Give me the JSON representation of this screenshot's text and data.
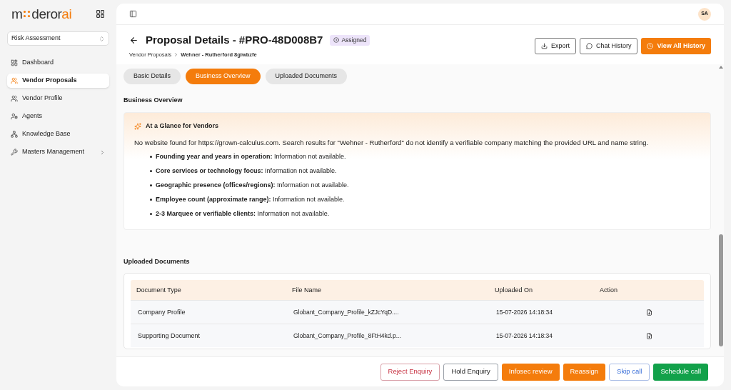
{
  "sidebar": {
    "logo": {
      "start": "m",
      "middle": "deror",
      "accent": "ai"
    },
    "workspace": "Risk Assessment",
    "items": [
      {
        "label": "Dashboard",
        "selected": false,
        "has_children": false
      },
      {
        "label": "Vendor Proposals",
        "selected": true,
        "has_children": false
      },
      {
        "label": "Vendor Profile",
        "selected": false,
        "has_children": false
      },
      {
        "label": "Agents",
        "selected": false,
        "has_children": false
      },
      {
        "label": "Knowledge Base",
        "selected": false,
        "has_children": false
      },
      {
        "label": "Masters Management",
        "selected": false,
        "has_children": true
      }
    ]
  },
  "topbar": {
    "avatar": "SA"
  },
  "header": {
    "title": "Proposal Details - #PRO-48D008B7",
    "status": "Assigned",
    "breadcrumb": [
      "Vendor Proposals",
      "Wehner - Rutherford 8giwbzfe"
    ],
    "actions": [
      {
        "label": "Export",
        "kind": "export"
      },
      {
        "label": "Chat History",
        "kind": "chat"
      },
      {
        "label": "View All History",
        "kind": "history"
      }
    ]
  },
  "tabs": [
    {
      "label": "Basic Details",
      "selected": false
    },
    {
      "label": "Business Overview",
      "selected": true
    },
    {
      "label": "Uploaded Documents",
      "selected": false
    }
  ],
  "business_overview": {
    "heading": "Business Overview",
    "card_title": "At a Glance for Vendors",
    "intro": "No website found for https://grown-calculus.com. Search results for \"Wehner - Rutherford\" do not identify a verifiable company matching the provided URL and name string.",
    "facts": [
      {
        "label": "Founding year and years in operation:",
        "value": "Information not available."
      },
      {
        "label": "Core services or technology focus:",
        "value": "Information not available."
      },
      {
        "label": "Geographic presence (offices/regions):",
        "value": "Information not available."
      },
      {
        "label": "Employee count (approximate range):",
        "value": "Information not available."
      },
      {
        "label": "2-3 Marquee or verifiable clients:",
        "value": "Information not available."
      }
    ]
  },
  "documents": {
    "heading": "Uploaded Documents",
    "columns": [
      "Document Type",
      "File Name",
      "Uploaded On",
      "Action"
    ],
    "rows": [
      {
        "type": "Company Profile",
        "file": "Globant_Company_Profile_kZJcYqD....",
        "uploaded": "15-07-2026 14:18:34"
      },
      {
        "type": "Supporting Document",
        "file": "Globant_Company_Profile_8FtH4kd.p...",
        "uploaded": "15-07-2026 14:18:34"
      }
    ]
  },
  "footer_buttons": [
    {
      "label": "Reject Enquiry",
      "kind": "danger"
    },
    {
      "label": "Hold Enquiry",
      "kind": "neutral"
    },
    {
      "label": "Infosec review",
      "kind": "primary"
    },
    {
      "label": "Reassign",
      "kind": "primary"
    },
    {
      "label": "Skip call",
      "kind": "link"
    },
    {
      "label": "Schedule call",
      "kind": "success"
    }
  ]
}
